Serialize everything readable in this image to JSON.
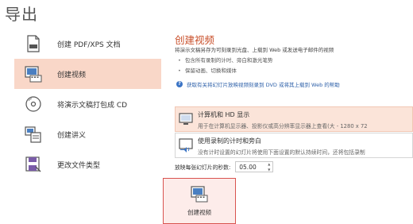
{
  "page": {
    "title": "导出"
  },
  "nav": {
    "items": [
      {
        "label": "创建 PDF/XPS 文档",
        "icon": "pdf-document-icon"
      },
      {
        "label": "创建视频",
        "icon": "video-icon",
        "active": true
      },
      {
        "label": "将演示文稿打包成 CD",
        "icon": "cd-icon"
      },
      {
        "label": "创建讲义",
        "icon": "handout-icon"
      },
      {
        "label": "更改文件类型",
        "icon": "save-file-icon"
      }
    ]
  },
  "main": {
    "section_title": "创建视频",
    "description": "将演示文稿另存为可刻录到光盘、上载到 Web 或发送电子邮件的视频",
    "bullets": [
      "包含所有录制的计时、旁白和激光笔势",
      "保留动画、切换和媒体"
    ],
    "help_link": "获取有关将幻灯片放映视频刻录到 DVD 或将其上载到 Web 的帮助",
    "quality_option": {
      "title": "计算机和 HD 显示",
      "subtitle": "用于在计算机显示器、投影仪或高分辨率显示器上查看(大 - 1280 x 72"
    },
    "timing_option": {
      "title": "使用录制的计时和旁白",
      "subtitle": "没有计时设置的幻灯片将使用下面设置的默认持续时间，还将包括录制"
    },
    "seconds_label": "放映每张幻灯片的秒数:",
    "seconds_value": "05.00",
    "create_button": "创建视频"
  },
  "colors": {
    "accent": "#c9502b",
    "active_bg": "#f9d7c8",
    "button_border": "#d9534f"
  }
}
